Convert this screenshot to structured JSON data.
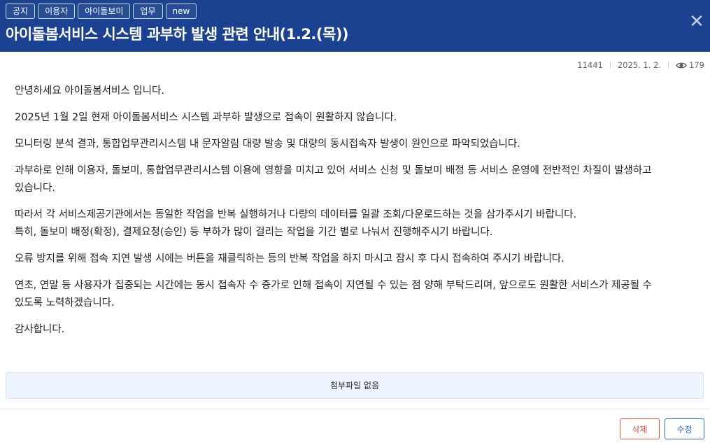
{
  "header": {
    "tags": [
      "공지",
      "이용자",
      "아이돌보미",
      "업무",
      "new"
    ],
    "title": "아이돌봄서비스 시스템 과부하 발생 관련 안내(1.2.(목))",
    "close_icon": "✕"
  },
  "meta": {
    "post_number": "11441",
    "date": "2025. 1. 2.",
    "views": "179"
  },
  "content": {
    "paragraphs": [
      [
        "안녕하세요 아이돌봄서비스 입니다."
      ],
      [
        "2025년 1월 2일 현재 아이돌봄서비스 시스템 과부하 발생으로 접속이 원활하지 않습니다."
      ],
      [
        "모니터링 분석 결과, 통합업무관리시스템 내 문자알림 대량 발송 및 대량의 동시접속자 발생이 원인으로 파악되었습니다."
      ],
      [
        "과부하로 인해 이용자, 돌보미, 통합업무관리시스템 이용에 영향을 미치고 있어 서비스 신청 및 돌보미 배정 등 서비스 운영에 전반적인 차질이 발생하고",
        "있습니다."
      ],
      [
        "따라서 각 서비스제공기관에서는 동일한 작업을 반복 실행하거나 다량의 데이터를 일괄 조회/다운로드하는 것을 삼가주시기 바랍니다.",
        "특히, 돌보미 배정(확정), 결제요청(승인) 등 부하가 많이 걸리는 작업을 기간 별로 나눠서 진행해주시기 바랍니다."
      ],
      [
        "오류 방지를 위해 접속 지연 발생 시에는 버튼을 재클릭하는 등의 반복 작업을 하지 마시고 잠시 후 다시 접속하여 주시기 바랍니다."
      ],
      [
        "연초, 연말 등 사용자가 집중되는 시간에는 동시 접속자 수 증가로 인해 접속이 지연될 수 있는 점 양해 부탁드리며, 앞으로도 원활한 서비스가 제공될 수",
        "있도록 노력하겠습니다."
      ],
      [
        "감사합니다."
      ]
    ]
  },
  "attachments": {
    "empty_label": "첨부파일 없음"
  },
  "actions": {
    "delete_label": "삭제",
    "edit_label": "수정"
  },
  "colors": {
    "header_bg": "#1c4190",
    "delete": "#d9534f",
    "edit": "#2a6bd8",
    "attach_bg": "#eef4fd"
  }
}
